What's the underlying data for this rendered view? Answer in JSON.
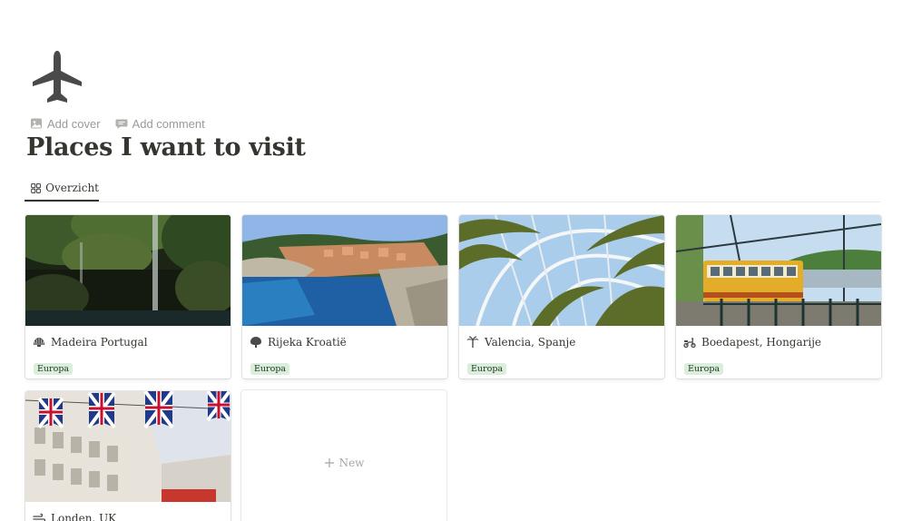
{
  "page": {
    "icon": "airplane-icon",
    "title": "Places I want to visit"
  },
  "controls": {
    "add_cover": "Add cover",
    "add_comment": "Add comment"
  },
  "views": [
    {
      "label": "Overzicht",
      "icon": "gallery-grid-icon",
      "active": true
    }
  ],
  "cards": [
    {
      "name": "Madeira Portugal",
      "icon": "shell-icon",
      "tag": "Europa",
      "cover": "waterfall-forest"
    },
    {
      "name": "Rijeka Kroatië",
      "icon": "tree-icon",
      "tag": "Europa",
      "cover": "coastal-old-town"
    },
    {
      "name": "Valencia, Spanje",
      "icon": "palm-tree-icon",
      "tag": "Europa",
      "cover": "palm-dome"
    },
    {
      "name": "Boedapest, Hongarije",
      "icon": "scooter-icon",
      "tag": "Europa",
      "cover": "yellow-tram"
    },
    {
      "name": "Londen, UK",
      "icon": "wind-icon",
      "tag": "",
      "cover": "union-jack-street"
    }
  ],
  "new_card": {
    "label": "New"
  },
  "colors": {
    "tag_bg": "#dbeddb",
    "tag_text": "#1c3829",
    "text": "#37352f",
    "muted": "#9b9a97"
  }
}
